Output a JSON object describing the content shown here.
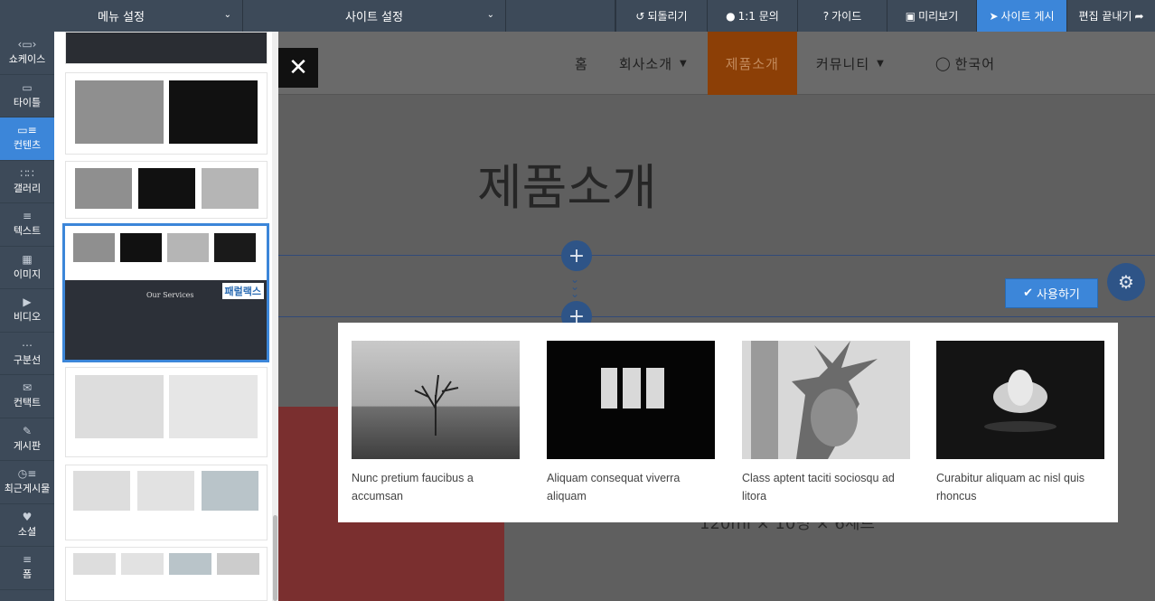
{
  "topbar": {
    "menu_settings": "메뉴 설정",
    "site_settings": "사이트 설정",
    "undo": "되돌리기",
    "inquiry": "1:1 문의",
    "guide": "가이드",
    "preview": "미리보기",
    "publish": "사이트 게시",
    "finish": "편집 끝내기"
  },
  "nav": [
    {
      "label": "쇼케이스",
      "icon": "showcase-icon"
    },
    {
      "label": "타이틀",
      "icon": "title-icon"
    },
    {
      "label": "컨텐츠",
      "icon": "content-icon"
    },
    {
      "label": "갤러리",
      "icon": "gallery-icon"
    },
    {
      "label": "텍스트",
      "icon": "text-icon"
    },
    {
      "label": "이미지",
      "icon": "image-icon"
    },
    {
      "label": "비디오",
      "icon": "video-icon"
    },
    {
      "label": "구분선",
      "icon": "divider-icon"
    },
    {
      "label": "컨택트",
      "icon": "contact-icon"
    },
    {
      "label": "게시판",
      "icon": "board-icon"
    },
    {
      "label": "최근게시물",
      "icon": "recent-posts-icon"
    },
    {
      "label": "소셜",
      "icon": "social-icon"
    },
    {
      "label": "폼",
      "icon": "form-icon"
    }
  ],
  "panel": {
    "parallax_badge": "패럴랙스",
    "services_title": "Our Services"
  },
  "site": {
    "menu": [
      "홈",
      "회사소개",
      "제품소개",
      "커뮤니티",
      "한국어"
    ],
    "heading": "제품소개",
    "use_button": "사용하기",
    "bg_text": "120ml × 10병 × 6세트"
  },
  "preview_cards": [
    {
      "caption": "Nunc pretium faucibus a accumsan"
    },
    {
      "caption": "Aliquam consequat viverra aliquam"
    },
    {
      "caption": "Class aptent taciti sociosqu ad litora"
    },
    {
      "caption": "Curabitur aliquam ac nisl quis rhoncus"
    }
  ]
}
